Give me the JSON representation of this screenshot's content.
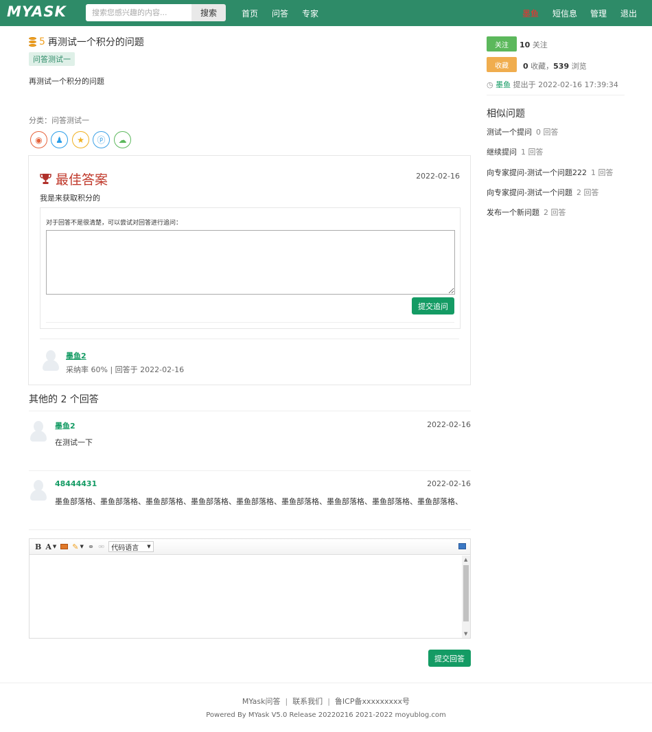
{
  "header": {
    "logo": "MYASK",
    "search_placeholder": "搜索您感兴趣的内容...",
    "search_button": "搜索",
    "nav": [
      "首页",
      "问答",
      "专家"
    ],
    "user": "墨鱼",
    "right_nav": [
      "短信息",
      "管理",
      "退出"
    ]
  },
  "question": {
    "reward": "5",
    "title": "再测试一个积分的问题",
    "tag": "问答测试一",
    "body": "再测试一个积分的问题",
    "category": "分类：问答测试一"
  },
  "share_icons": [
    "weibo-icon",
    "qq-icon",
    "qzone-icon",
    "pengyou-icon",
    "wechat-icon"
  ],
  "best_answer": {
    "heading": "最佳答案",
    "date": "2022-02-16",
    "text": "我是来获取积分的",
    "follow_label": "对于回答不是很清楚，可以尝试对回答进行追问：",
    "follow_button": "提交追问",
    "user": "墨鱼2",
    "meta": "采纳率 60% | 回答于 2022-02-16"
  },
  "others": {
    "title": "其他的 2 个回答",
    "answers": [
      {
        "user": "墨鱼2",
        "date": "2022-02-16",
        "text": "在测试一下"
      },
      {
        "user": "48444431",
        "date": "2022-02-16",
        "text": "墨鱼部落格、墨鱼部落格、墨鱼部落格、墨鱼部落格、墨鱼部落格、墨鱼部落格、墨鱼部落格、墨鱼部落格、墨鱼部落格、"
      }
    ]
  },
  "editor": {
    "bold": "B",
    "font": "A",
    "code_language": "代码语言",
    "submit": "提交回答"
  },
  "sidebar": {
    "follow_button": "关注",
    "follow_count": "10",
    "follow_label": "关注",
    "collect_button": "收藏",
    "collect_count": "0",
    "collect_label": "收藏，",
    "view_count": "539",
    "view_label": "浏览",
    "asker": "墨鱼",
    "asked_at": "提出于 2022-02-16 17:39:34",
    "similar_title": "相似问题",
    "similar": [
      {
        "title": "测试一个提问",
        "count": "0 回答"
      },
      {
        "title": "继续提问",
        "count": "1 回答"
      },
      {
        "title": "向专家提问-测试一个问题222",
        "count": "1 回答"
      },
      {
        "title": "向专家提问-测试一个问题",
        "count": "2 回答"
      },
      {
        "title": "发布一个新问题",
        "count": "2 回答"
      }
    ]
  },
  "footer": {
    "links": [
      "MYask问答",
      "联系我们",
      "鲁ICP备xxxxxxxxx号"
    ],
    "powered": "Powered By MYask V5.0 Release 20220216 2021-2022 moyublog.com"
  },
  "colors": {
    "header_bg": "#2e8b68",
    "primary_button": "#149b64",
    "follow_button": "#5cb85c",
    "collect_button": "#f0ad4e",
    "best_answer_red": "#c0392b",
    "user_red": "#ff2a2a"
  }
}
